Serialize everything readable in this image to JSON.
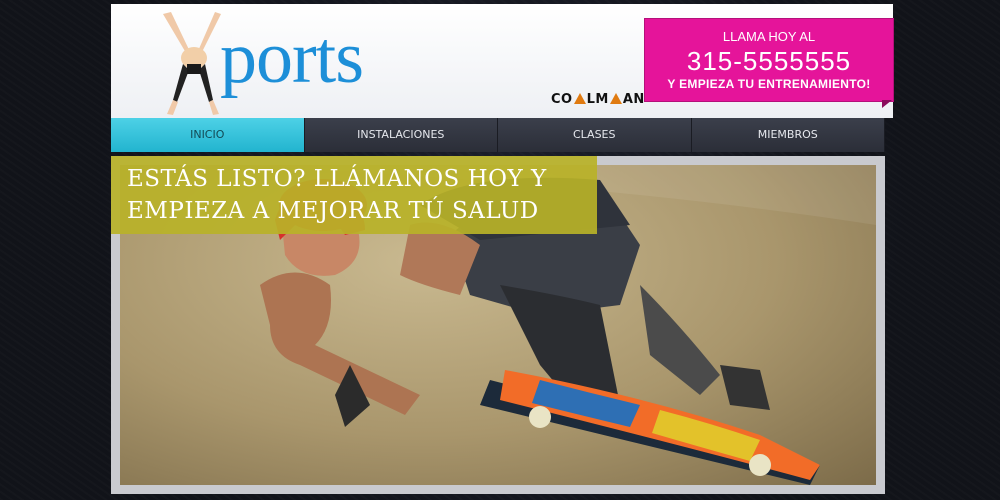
{
  "logo": {
    "text": "ports"
  },
  "brand": {
    "part1": "CO",
    "part2": "LM",
    "part3": "AN"
  },
  "cta": {
    "line1": "LLAMA HOY AL",
    "phone": "315-5555555",
    "line3": "Y EMPIEZA TU ENTRENAMIENTO!"
  },
  "nav": {
    "items": [
      {
        "label": "INICIO"
      },
      {
        "label": "INSTALACIONES"
      },
      {
        "label": "CLASES"
      },
      {
        "label": "MIEMBROS"
      }
    ]
  },
  "hero": {
    "caption": "ESTÁS LISTO? LLÁMANOS HOY Y EMPIEZA A MEJORAR TÚ SALUD"
  },
  "colors": {
    "accent": "#e5149a",
    "nav_active": "#22b4cf",
    "logo_blue": "#1d8fd8",
    "caption_bg": "#b9b228"
  }
}
